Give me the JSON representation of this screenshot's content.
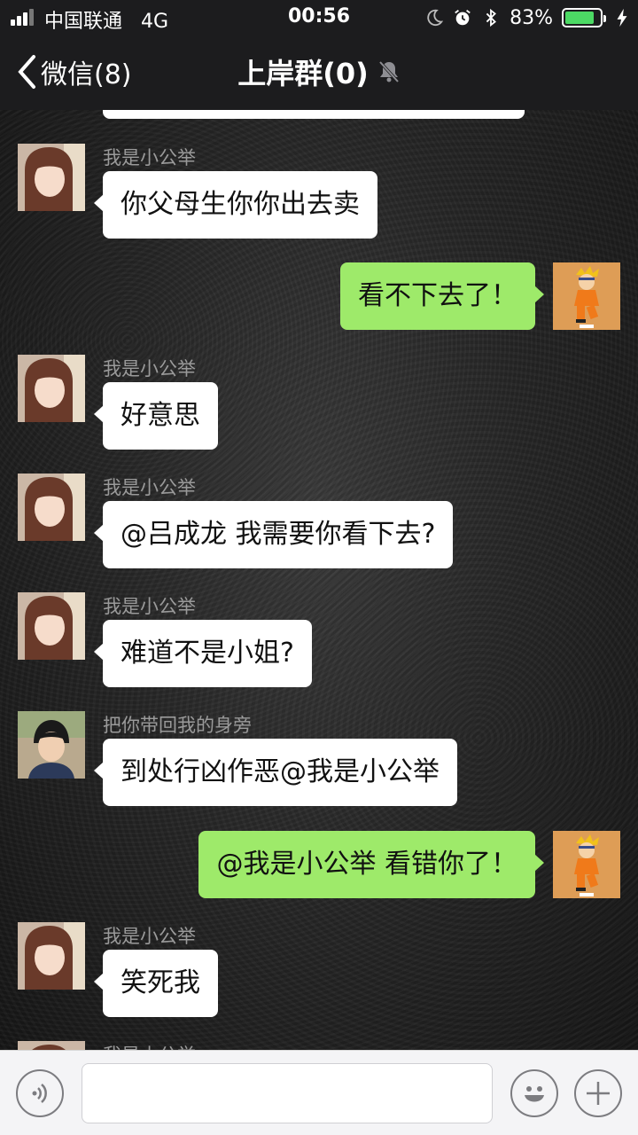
{
  "status_bar": {
    "carrier": "中国联通",
    "network": "4G",
    "time": "00:56",
    "battery_percent": "83%",
    "battery_level": 0.83,
    "icons": [
      "moon-icon",
      "alarm-icon",
      "bluetooth-icon",
      "charging-icon"
    ]
  },
  "nav": {
    "back_label": "微信(8)",
    "title": "上岸群(0)",
    "mute_icon": "bell-muted-icon"
  },
  "messages": [
    {
      "direction": "in",
      "sender": "我是小公举",
      "avatar": "avatar-girl",
      "text": "你父母生你你出去卖"
    },
    {
      "direction": "out",
      "sender": "",
      "avatar": "avatar-naruto",
      "text": "看不下去了！"
    },
    {
      "direction": "in",
      "sender": "我是小公举",
      "avatar": "avatar-girl",
      "text": "好意思"
    },
    {
      "direction": "in",
      "sender": "我是小公举",
      "avatar": "avatar-girl",
      "text": "@吕成龙 我需要你看下去?"
    },
    {
      "direction": "in",
      "sender": "我是小公举",
      "avatar": "avatar-girl",
      "text": "难道不是小姐?"
    },
    {
      "direction": "in",
      "sender": "把你带回我的身旁",
      "avatar": "avatar-boy",
      "text": "到处行凶作恶@我是小公举"
    },
    {
      "direction": "out",
      "sender": "",
      "avatar": "avatar-naruto",
      "text": "@我是小公举 看错你了！"
    },
    {
      "direction": "in",
      "sender": "我是小公举",
      "avatar": "avatar-girl",
      "text": "笑死我"
    }
  ],
  "partial_next_sender": "我是小公举",
  "input_bar": {
    "placeholder": "",
    "voice_icon": "voice-icon",
    "emoji_icon": "emoji-icon",
    "plus_icon": "plus-icon"
  },
  "colors": {
    "header_bg": "#1c1c1e",
    "bubble_in": "#ffffff",
    "bubble_out": "#9eea6a",
    "battery_green": "#4cd964"
  }
}
